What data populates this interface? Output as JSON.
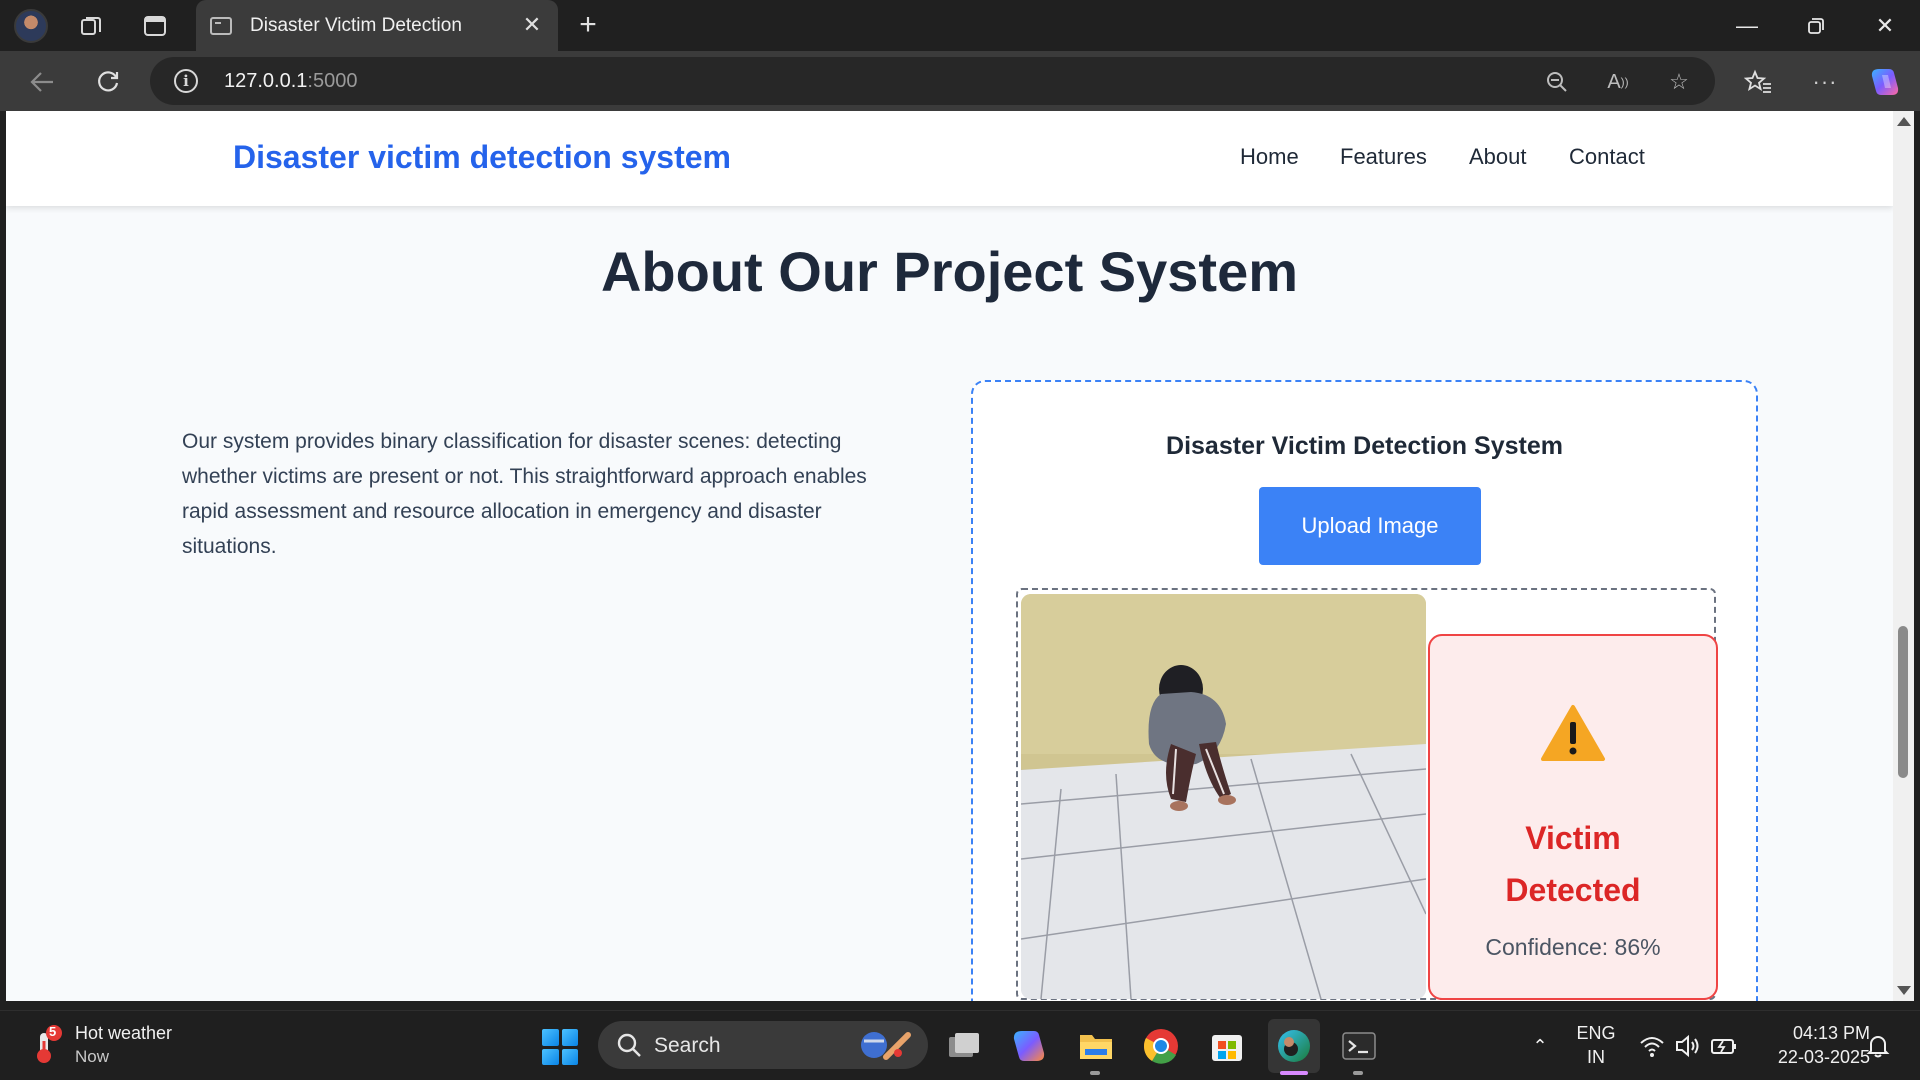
{
  "browser": {
    "tab_title": "Disaster Victim Detection",
    "url_host": "127.0.0.1",
    "url_port": ":5000"
  },
  "navbar": {
    "brand": "Disaster victim detection system",
    "links": [
      "Home",
      "Features",
      "About",
      "Contact"
    ]
  },
  "about": {
    "title": "About Our Project System",
    "description": "Our system provides binary classification for disaster scenes: detecting whether victims are present or not. This straightforward approach enables rapid assessment and resource allocation in emergency and disaster situations."
  },
  "demo": {
    "title": "Disaster Victim Detection System",
    "upload_label": "Upload Image",
    "result_line1": "Victim",
    "result_line2": "Detected",
    "confidence_label": "Confidence: 86%",
    "confidence_value": 0.86
  },
  "taskbar": {
    "weather_title": "Hot weather",
    "weather_sub": "Now",
    "weather_badge": "5",
    "search_placeholder": "Search",
    "lang_line1": "ENG",
    "lang_line2": "IN",
    "time": "04:13 PM",
    "date": "22-03-2025"
  },
  "colors": {
    "brand": "#2563eb",
    "upload_button": "#3b82f6",
    "detected": "#dc2626"
  },
  "icons": [
    "profile-avatar-icon",
    "workspaces-icon",
    "tab-actions-icon",
    "back-icon",
    "refresh-icon",
    "info-icon",
    "zoom-out-icon",
    "read-aloud-icon",
    "favorite-star-icon",
    "favorites-icon",
    "more-icon",
    "copilot-icon",
    "warning-icon",
    "start-icon",
    "search-icon",
    "file-explorer-icon",
    "chrome-icon",
    "store-icon",
    "edge-icon",
    "terminal-icon",
    "wifi-icon",
    "volume-icon",
    "battery-icon"
  ]
}
